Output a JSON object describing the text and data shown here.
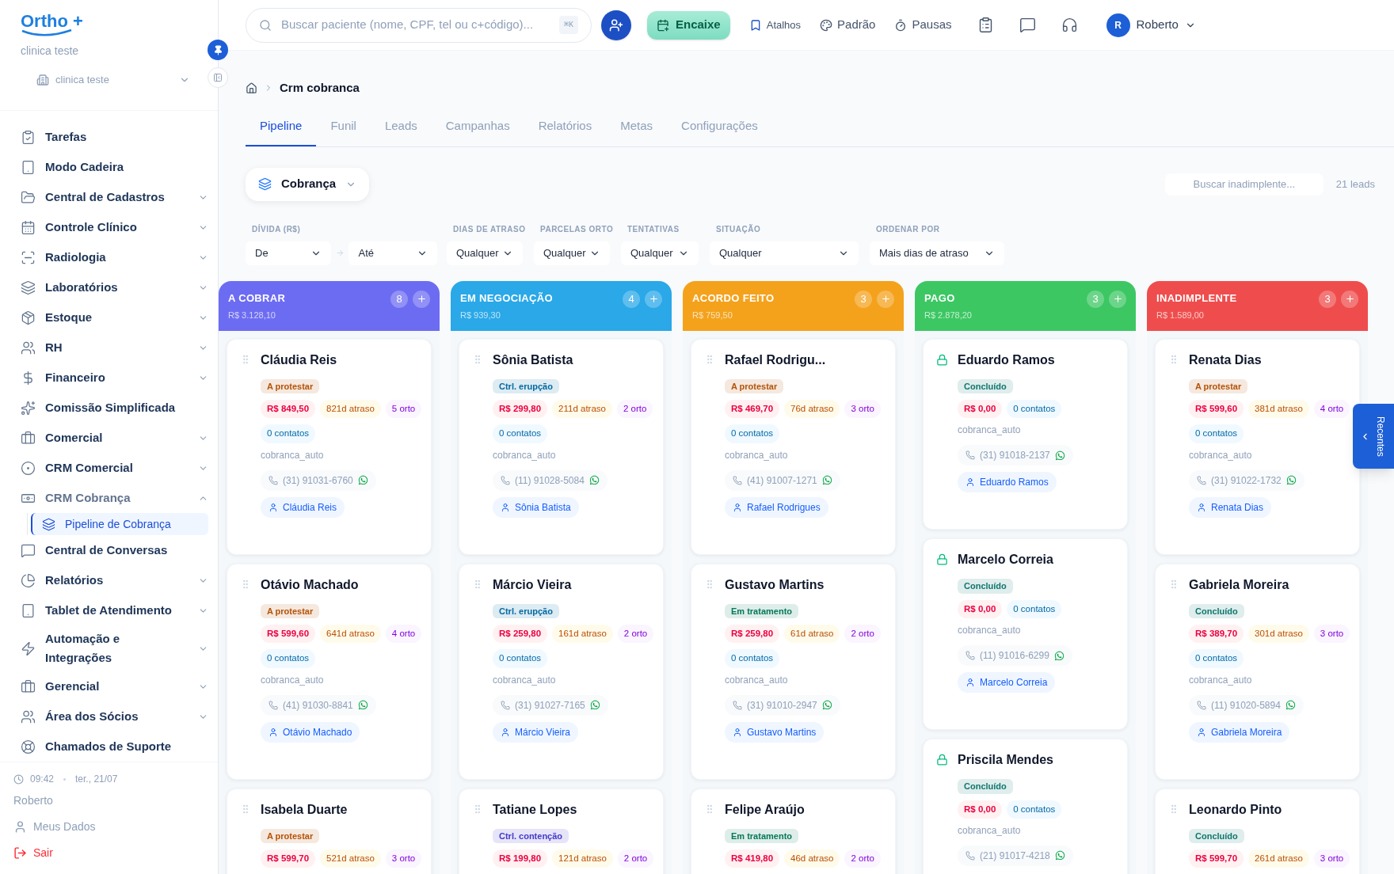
{
  "sidebar": {
    "logo": "Ortho +",
    "clinic_name": "clinica teste",
    "clinic_select": "clinica teste",
    "items": [
      {
        "label": "Tarefas",
        "kind": "link"
      },
      {
        "label": "Modo Cadeira",
        "kind": "link"
      },
      {
        "label": "Central de Cadastros",
        "kind": "group",
        "expanded": false
      },
      {
        "label": "Controle Clínico",
        "kind": "group",
        "expanded": false
      },
      {
        "label": "Radiologia",
        "kind": "group",
        "expanded": false
      },
      {
        "label": "Laboratórios",
        "kind": "group",
        "expanded": false
      },
      {
        "label": "Estoque",
        "kind": "group",
        "expanded": false
      },
      {
        "label": "RH",
        "kind": "group",
        "expanded": false
      },
      {
        "label": "Financeiro",
        "kind": "group",
        "expanded": false
      },
      {
        "label": "Comissão Simplificada",
        "kind": "link"
      },
      {
        "label": "Comercial",
        "kind": "group",
        "expanded": false
      },
      {
        "label": "CRM Comercial",
        "kind": "group",
        "expanded": false
      },
      {
        "label": "CRM Cobrança",
        "kind": "group",
        "expanded": true,
        "children": [
          {
            "label": "Pipeline de Cobrança",
            "selected": true
          }
        ]
      },
      {
        "label": "Central de Conversas",
        "kind": "link"
      },
      {
        "label": "Relatórios",
        "kind": "group",
        "expanded": false
      },
      {
        "label": "Tablet de Atendimento",
        "kind": "group",
        "expanded": false
      },
      {
        "label": "Automação e Integrações",
        "kind": "group",
        "expanded": false
      },
      {
        "label": "Gerencial",
        "kind": "group",
        "expanded": false
      },
      {
        "label": "Área dos Sócios",
        "kind": "group",
        "expanded": false
      },
      {
        "label": "Chamados de Suporte",
        "kind": "link"
      }
    ],
    "footer": {
      "time": "09:42",
      "date": "ter., 21/07",
      "user": "Roberto",
      "profile": "Meus Dados",
      "logout": "Sair"
    }
  },
  "topbar": {
    "search": {
      "placeholder": "Buscar paciente (nome, CPF, tel ou c+código)...",
      "shortcut": "⌘K"
    },
    "encaixe": "Encaixe",
    "links": [
      "Atalhos",
      "Padrão",
      "Pausas"
    ],
    "user": {
      "initial": "R",
      "name": "Roberto"
    }
  },
  "breadcrumb": "Crm cobranca",
  "tabs": [
    {
      "label": "Pipeline",
      "selected": true
    },
    {
      "label": "Funil",
      "selected": false
    },
    {
      "label": "Leads",
      "selected": false
    },
    {
      "label": "Campanhas",
      "selected": false
    },
    {
      "label": "Relatórios",
      "selected": false
    },
    {
      "label": "Metas",
      "selected": false
    },
    {
      "label": "Configurações",
      "selected": false
    }
  ],
  "pipeline_select": "Cobrança",
  "lead_search": {
    "placeholder": "Buscar inadimplente..."
  },
  "lead_count": "21 leads",
  "filters": [
    {
      "label": "DÍVIDA (R$)",
      "fields": [
        "De",
        "Até"
      ]
    },
    {
      "label": "DIAS DE ATRASO",
      "fields": [
        "Qualquer"
      ]
    },
    {
      "label": "PARCELAS ORTO",
      "fields": [
        "Qualquer"
      ]
    },
    {
      "label": "TENTATIVAS",
      "fields": [
        "Qualquer"
      ]
    },
    {
      "label": "SITUAÇÃO",
      "fields": [
        "Qualquer"
      ]
    },
    {
      "label": "ORDENAR POR",
      "fields": [
        "Mais dias de atraso"
      ]
    }
  ],
  "columns": [
    {
      "title": "A COBRAR",
      "total": "R$ 3.128,10",
      "count": "8",
      "color": "#6c6cf3",
      "cards": [
        {
          "name": "Cláudia Reis",
          "kind": "drag",
          "tag": {
            "label": "A protestar",
            "color": "#b45309"
          },
          "amount": "R$ 849,50",
          "delay": "821d atraso",
          "orto": "5 orto",
          "contacts": "0 contatos",
          "source": "cobranca_auto",
          "phone": "(31) 91031-6760",
          "person": "Cláudia Reis"
        },
        {
          "name": "Otávio Machado",
          "kind": "drag",
          "tag": {
            "label": "A protestar",
            "color": "#b45309"
          },
          "amount": "R$ 599,60",
          "delay": "641d atraso",
          "orto": "4 orto",
          "contacts": "0 contatos",
          "source": "cobranca_auto",
          "phone": "(41) 91030-8841",
          "person": "Otávio Machado"
        },
        {
          "name": "Isabela Duarte",
          "kind": "drag",
          "tag": {
            "label": "A protestar",
            "color": "#b45309"
          },
          "amount": "R$ 599,70",
          "delay": "521d atraso",
          "orto": "3 orto"
        }
      ]
    },
    {
      "title": "EM NEGOCIAÇÃO",
      "total": "R$ 939,30",
      "count": "4",
      "color": "#2aa8e8",
      "cards": [
        {
          "name": "Sônia Batista",
          "kind": "drag",
          "tag": {
            "label": "Ctrl. erupção",
            "color": "#0369a1"
          },
          "amount": "R$ 299,80",
          "delay": "211d atraso",
          "orto": "2 orto",
          "contacts": "0 contatos",
          "source": "cobranca_auto",
          "phone": "(11) 91028-5084",
          "person": "Sônia Batista"
        },
        {
          "name": "Márcio Vieira",
          "kind": "drag",
          "tag": {
            "label": "Ctrl. erupção",
            "color": "#0369a1"
          },
          "amount": "R$ 259,80",
          "delay": "161d atraso",
          "orto": "2 orto",
          "contacts": "0 contatos",
          "source": "cobranca_auto",
          "phone": "(31) 91027-7165",
          "person": "Márcio Vieira"
        },
        {
          "name": "Tatiane Lopes",
          "kind": "drag",
          "tag": {
            "label": "Ctrl. contenção",
            "color": "#4338ca"
          },
          "amount": "R$ 199,80",
          "delay": "121d atraso",
          "orto": "2 orto"
        }
      ]
    },
    {
      "title": "ACORDO FEITO",
      "total": "R$ 759,50",
      "count": "3",
      "color": "#f4a21c",
      "cards": [
        {
          "name": "Rafael Rodrigu...",
          "kind": "drag",
          "tag": {
            "label": "A protestar",
            "color": "#b45309"
          },
          "amount": "R$ 469,70",
          "delay": "76d atraso",
          "orto": "3 orto",
          "contacts": "0 contatos",
          "source": "cobranca_auto",
          "phone": "(41) 91007-1271",
          "person": "Rafael Rodrigues"
        },
        {
          "name": "Gustavo Martins",
          "kind": "drag",
          "tag": {
            "label": "Em tratamento",
            "color": "#047857"
          },
          "amount": "R$ 259,80",
          "delay": "61d atraso",
          "orto": "2 orto",
          "contacts": "0 contatos",
          "source": "cobranca_auto",
          "phone": "(31) 91010-2947",
          "person": "Gustavo Martins"
        },
        {
          "name": "Felipe Araújo",
          "kind": "drag",
          "tag": {
            "label": "Em tratamento",
            "color": "#047857"
          },
          "amount": "R$ 419,80",
          "delay": "46d atraso",
          "orto": "2 orto"
        }
      ]
    },
    {
      "title": "PAGO",
      "total": "R$ 2.878,20",
      "count": "3",
      "color": "#3cc763",
      "cards": [
        {
          "name": "Eduardo Ramos",
          "kind": "lock",
          "tag": {
            "label": "Concluído",
            "color": "#0f766e"
          },
          "amount": "R$ 0,00",
          "contacts": "0 contatos",
          "source": "cobranca_auto",
          "phone": "(31) 91018-2137",
          "person": "Eduardo Ramos"
        },
        {
          "name": "Marcelo Correia",
          "kind": "lock",
          "tag": {
            "label": "Concluído",
            "color": "#0f766e"
          },
          "amount": "R$ 0,00",
          "contacts": "0 contatos",
          "source": "cobranca_auto",
          "phone": "(11) 91016-6299",
          "person": "Marcelo Correia"
        },
        {
          "name": "Priscila Mendes",
          "kind": "lock",
          "tag": {
            "label": "Concluído",
            "color": "#0f766e"
          },
          "amount": "R$ 0,00",
          "contacts": "0 contatos",
          "source": "cobranca_auto",
          "phone": "(21) 91017-4218"
        }
      ]
    },
    {
      "title": "INADIMPLENTE",
      "total": "R$ 1.589,00",
      "count": "3",
      "color": "#ef4d4d",
      "cards": [
        {
          "name": "Renata Dias",
          "kind": "drag",
          "tag": {
            "label": "A protestar",
            "color": "#b45309"
          },
          "amount": "R$ 599,60",
          "delay": "381d atraso",
          "orto": "4 orto",
          "contacts": "0 contatos",
          "source": "cobranca_auto",
          "phone": "(31) 91022-1732",
          "person": "Renata Dias"
        },
        {
          "name": "Gabriela Moreira",
          "kind": "drag",
          "tag": {
            "label": "Concluído",
            "color": "#0f766e"
          },
          "amount": "R$ 389,70",
          "delay": "301d atraso",
          "orto": "3 orto",
          "contacts": "0 contatos",
          "source": "cobranca_auto",
          "phone": "(11) 91020-5894",
          "person": "Gabriela Moreira"
        },
        {
          "name": "Leonardo Pinto",
          "kind": "drag",
          "tag": {
            "label": "Concluído",
            "color": "#0f766e"
          },
          "amount": "R$ 599,70",
          "delay": "261d atraso",
          "orto": "3 orto"
        }
      ]
    }
  ],
  "recent_tab": "Recentes"
}
